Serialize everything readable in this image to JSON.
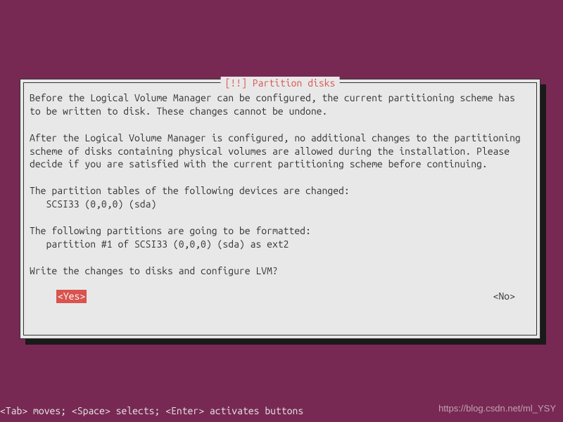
{
  "dialog": {
    "title": "[!!] Partition disks",
    "paragraphs": {
      "p1": "Before the Logical Volume Manager can be configured, the current partitioning scheme has to be written to disk. These changes cannot be undone.",
      "p2": "After the Logical Volume Manager is configured, no additional changes to the partitioning scheme of disks containing physical volumes are allowed during the installation. Please decide if you are satisfied with the current partitioning scheme before continuing.",
      "p3": "The partition tables of the following devices are changed:",
      "p3_item": "   SCSI33 (0,0,0) (sda)",
      "p4": "The following partitions are going to be formatted:",
      "p4_item": "   partition #1 of SCSI33 (0,0,0) (sda) as ext2",
      "p5": "Write the changes to disks and configure LVM?"
    },
    "buttons": {
      "yes": "<Yes>",
      "no": "<No>"
    }
  },
  "footer": {
    "hint": "<Tab> moves; <Space> selects; <Enter> activates buttons"
  },
  "watermark": "https://blog.csdn.net/ml_YSY"
}
